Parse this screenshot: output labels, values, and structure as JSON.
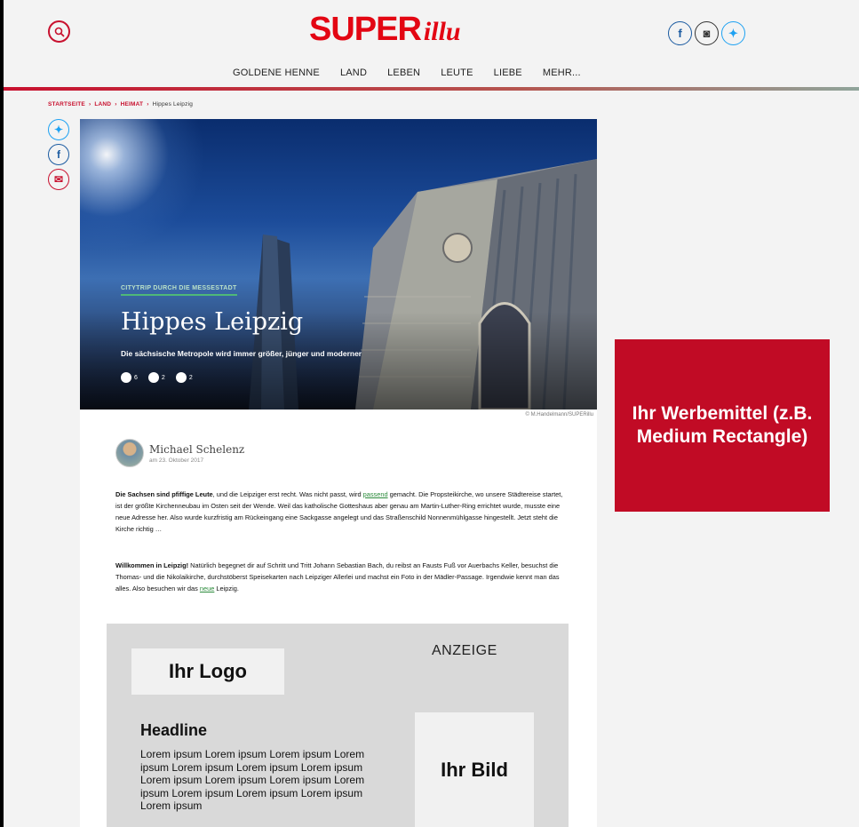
{
  "brand": {
    "logo_super": "SUPER",
    "logo_illu": "illu",
    "accent": "#e30613"
  },
  "header": {
    "search_icon": "search-icon",
    "social": [
      {
        "icon": "facebook-icon",
        "glyph": "f"
      },
      {
        "icon": "instagram-icon",
        "glyph": "◙"
      },
      {
        "icon": "twitter-icon",
        "glyph": "✦"
      }
    ]
  },
  "nav": {
    "items": [
      "GOLDENE HENNE",
      "LAND",
      "LEBEN",
      "LEUTE",
      "LIEBE",
      "MEHR..."
    ]
  },
  "breadcrumb": {
    "items": [
      "STARTSEITE",
      "LAND",
      "HEIMAT"
    ],
    "current": "Hippes Leipzig",
    "separator": "›"
  },
  "share": {
    "twitter_glyph": "✦",
    "facebook_glyph": "f",
    "mail_glyph": "✉"
  },
  "hero": {
    "kicker": "CITYTRIP DURCH DIE MESSESTADT",
    "title": "Hippes Leipzig",
    "subtitle": "Die sächsische Metropole wird immer größer, jünger und moderner",
    "reactions": [
      {
        "icon": "happy-face-icon",
        "count": "6"
      },
      {
        "icon": "neutral-face-icon",
        "count": "2"
      },
      {
        "icon": "sad-face-icon",
        "count": "2"
      }
    ],
    "credit": "© M.Handelmann/SUPERillu"
  },
  "author": {
    "name": "Michael Schelenz",
    "date": "am 23. Oktober 2017"
  },
  "body": {
    "p1_bold": "Die Sachsen sind pfiffige Leute",
    "p1_a": ", und die Leipziger erst recht. Was nicht passt, wird ",
    "p1_link": "passend",
    "p1_b": " gemacht. Die Propsteikirche, wo unsere Städtereise startet, ist der größte Kirchenneubau im Osten seit der Wende. Weil das katholische Gotteshaus aber genau am Martin-Luther-Ring errichtet wurde, musste eine neue Adresse her. Also wurde kurzfristig am Rückeingang eine Sackgasse angelegt und das Straßenschild Nonnenmühlgasse hingestellt. Jetzt steht die Kirche richtig …",
    "p2_bold": "Willkommen in Leipzig!",
    "p2_a": " Natürlich begegnet dir auf Schritt und Tritt Johann Sebastian Bach, du reibst an Fausts Fuß vor Auerbachs Keller, besuchst die Thomas- und die Nikolaikirche, durchstöberst Speisekarten nach Leipziger Allerlei und machst ein Foto in der Mädler-Passage. Irgendwie kennt man das alles. Also besuchen wir das ",
    "p2_link": "neue",
    "p2_b": " Leipzig."
  },
  "ad": {
    "label": "ANZEIGE",
    "logo": "Ihr Logo",
    "headline": "Headline",
    "lorem": "Lorem ipsum Lorem ipsum Lorem ipsum Lorem ipsum Lorem ipsum Lorem ipsum Lorem ipsum Lorem ipsum Lorem ipsum Lorem ipsum Lorem ipsum Lorem ipsum Lorem ipsum Lorem ipsum Lorem ipsum",
    "image": "Ihr Bild"
  },
  "banner": {
    "text": "Ihr Werbemittel (z.B. Medium Rectangle)",
    "color": "#c10b25"
  }
}
